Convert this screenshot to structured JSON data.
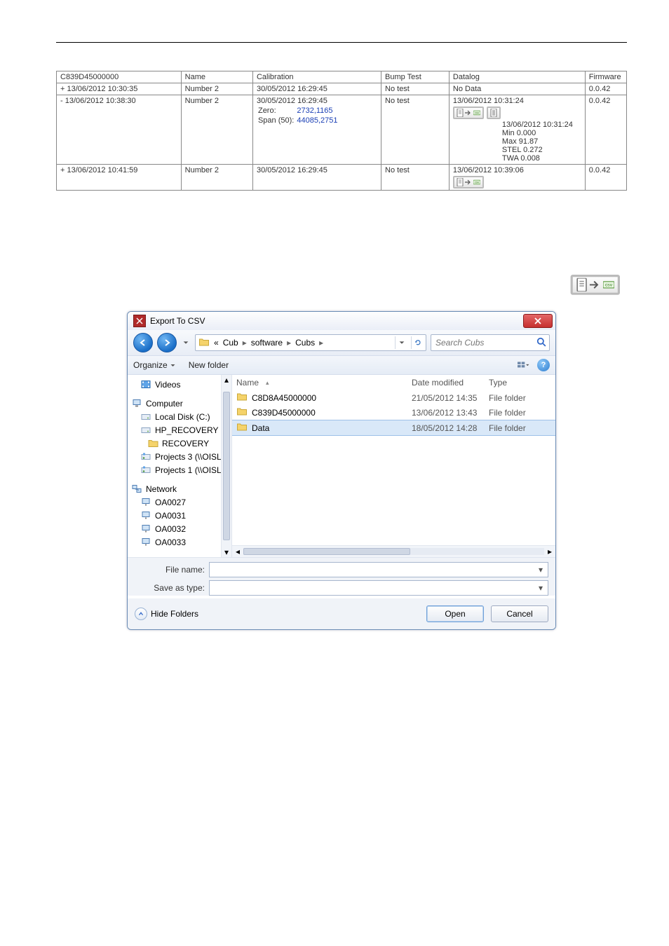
{
  "sessions_table": {
    "device_id": "C839D45000000",
    "headers": {
      "name": "Name",
      "calibration": "Calibration",
      "bump": "Bump Test",
      "datalog": "Datalog",
      "firmware": "Firmware"
    },
    "rows": [
      {
        "timestamp_prefix": "+",
        "timestamp": "13/06/2012 10:30:35",
        "name": "Number 2",
        "cal_ts": "30/05/2012 16:29:45",
        "zero_label": "",
        "zero_val": "",
        "span_label": "",
        "span_val": "",
        "bump": "No test",
        "datalog_ts": "No Data",
        "firmware": "0.0.42",
        "show_csv": false,
        "show_list": false,
        "detail": null
      },
      {
        "timestamp_prefix": "-",
        "timestamp": "13/06/2012 10:38:30",
        "name": "Number 2",
        "cal_ts": "30/05/2012 16:29:45",
        "zero_label": "Zero:",
        "zero_val": "2732,1165",
        "span_label": "Span (50):",
        "span_val": "44085,2751",
        "bump": "No test",
        "datalog_ts": "13/06/2012 10:31:24",
        "firmware": "0.0.42",
        "show_csv": true,
        "show_list": true,
        "detail": {
          "ts": "13/06/2012 10:31:24",
          "min": "Min 0.000",
          "max": "Max 91.87",
          "stel": "STEL 0.272",
          "twa": "TWA 0.008"
        }
      },
      {
        "timestamp_prefix": "+",
        "timestamp": "13/06/2012 10:41:59",
        "name": "Number 2",
        "cal_ts": "30/05/2012 16:29:45",
        "zero_label": "",
        "zero_val": "",
        "span_label": "",
        "span_val": "",
        "bump": "No test",
        "datalog_ts": "13/06/2012 10:39:06",
        "firmware": "0.0.42",
        "show_csv": true,
        "show_list": false,
        "detail": null
      }
    ]
  },
  "dialog": {
    "title": "Export To CSV",
    "breadcrumb": {
      "leading": "«",
      "parts": [
        "Cub",
        "software",
        "Cubs"
      ]
    },
    "search_placeholder": "Search Cubs",
    "toolbar": {
      "organize": "Organize",
      "new_folder": "New folder"
    },
    "sidebar": [
      {
        "label": "Videos",
        "icon": "videos",
        "indent": 1
      },
      {
        "spacer": true
      },
      {
        "label": "Computer",
        "icon": "computer",
        "indent": 0
      },
      {
        "label": "Local Disk (C:)",
        "icon": "drive",
        "indent": 1
      },
      {
        "label": "HP_RECOVERY (D",
        "icon": "drive2",
        "indent": 1
      },
      {
        "label": "RECOVERY",
        "icon": "folder",
        "indent": 2
      },
      {
        "label": "Projects 3 (\\\\OISL",
        "icon": "netdrive",
        "indent": 1
      },
      {
        "label": "Projects 1 (\\\\OISL",
        "icon": "netdrive",
        "indent": 1
      },
      {
        "spacer": true
      },
      {
        "label": "Network",
        "icon": "network",
        "indent": 0
      },
      {
        "label": "OA0027",
        "icon": "pc",
        "indent": 1
      },
      {
        "label": "OA0031",
        "icon": "pc",
        "indent": 1
      },
      {
        "label": "OA0032",
        "icon": "pc",
        "indent": 1
      },
      {
        "label": "OA0033",
        "icon": "pc",
        "indent": 1
      }
    ],
    "file_headers": {
      "name": "Name",
      "date": "Date modified",
      "type": "Type"
    },
    "files": [
      {
        "name": "C8D8A45000000",
        "date": "21/05/2012 14:35",
        "type": "File folder",
        "selected": false
      },
      {
        "name": "C839D45000000",
        "date": "13/06/2012 13:43",
        "type": "File folder",
        "selected": false
      },
      {
        "name": "Data",
        "date": "18/05/2012 14:28",
        "type": "File folder",
        "selected": true
      }
    ],
    "fields": {
      "file_name_label": "File name:",
      "save_as_type_label": "Save as type:"
    },
    "footer": {
      "hide_folders": "Hide Folders",
      "open": "Open",
      "cancel": "Cancel"
    }
  }
}
